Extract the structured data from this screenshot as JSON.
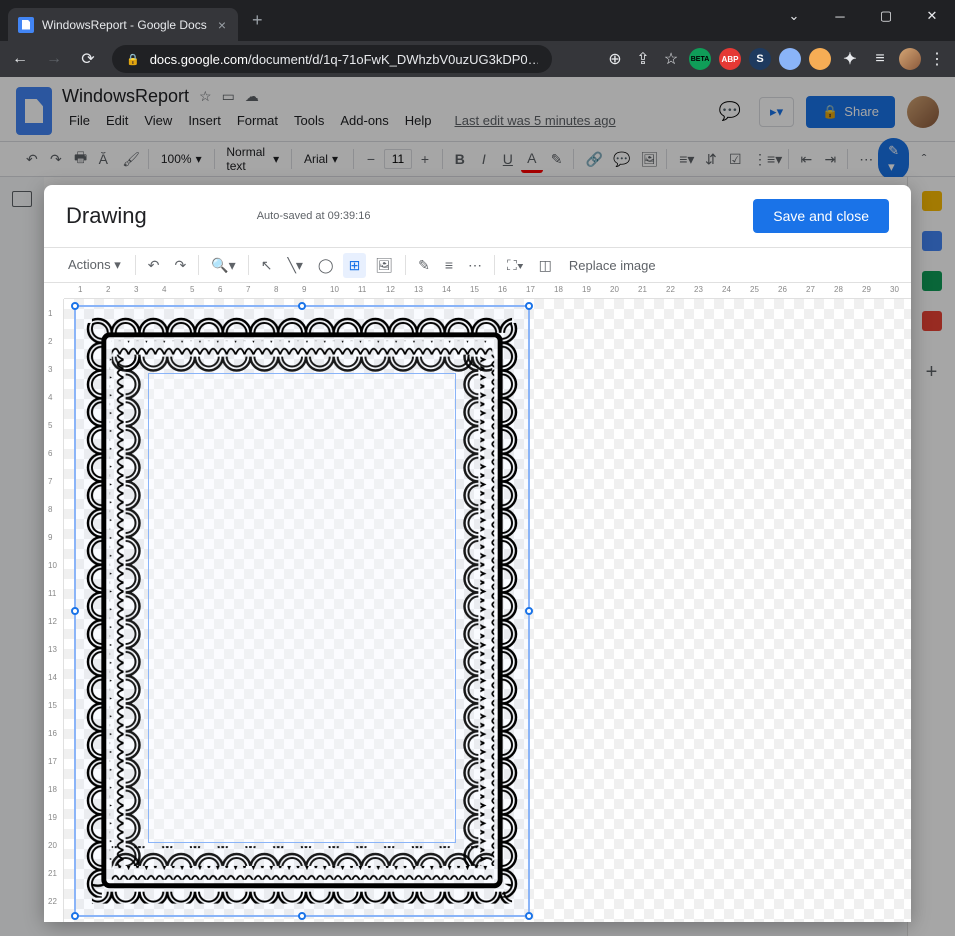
{
  "browser": {
    "tab_title": "WindowsReport - Google Docs",
    "url_host": "docs.google.com",
    "url_path": "/document/d/1q-71oFwK_DWhzbV0uzUG3kDP0…"
  },
  "docs": {
    "title": "WindowsReport",
    "menus": [
      "File",
      "Edit",
      "View",
      "Insert",
      "Format",
      "Tools",
      "Add-ons",
      "Help"
    ],
    "last_edit": "Last edit was 5 minutes ago",
    "share": "Share",
    "zoom": "100%",
    "style": "Normal text",
    "font": "Arial",
    "font_size": "11"
  },
  "drawing": {
    "title": "Drawing",
    "status": "Auto-saved at 09:39:16",
    "save": "Save and close",
    "actions": "Actions",
    "replace": "Replace image",
    "h_ruler": [
      "1",
      "2",
      "3",
      "4",
      "5",
      "6",
      "7",
      "8",
      "9",
      "10",
      "11",
      "12",
      "13",
      "14",
      "15",
      "16",
      "17",
      "18",
      "19",
      "20",
      "21",
      "22",
      "23",
      "24",
      "25",
      "26",
      "27",
      "28",
      "29",
      "30"
    ],
    "v_ruler": [
      "1",
      "2",
      "3",
      "4",
      "5",
      "6",
      "7",
      "8",
      "9",
      "10",
      "11",
      "12",
      "13",
      "14",
      "15",
      "16",
      "17",
      "18",
      "19",
      "20",
      "21",
      "22"
    ]
  }
}
